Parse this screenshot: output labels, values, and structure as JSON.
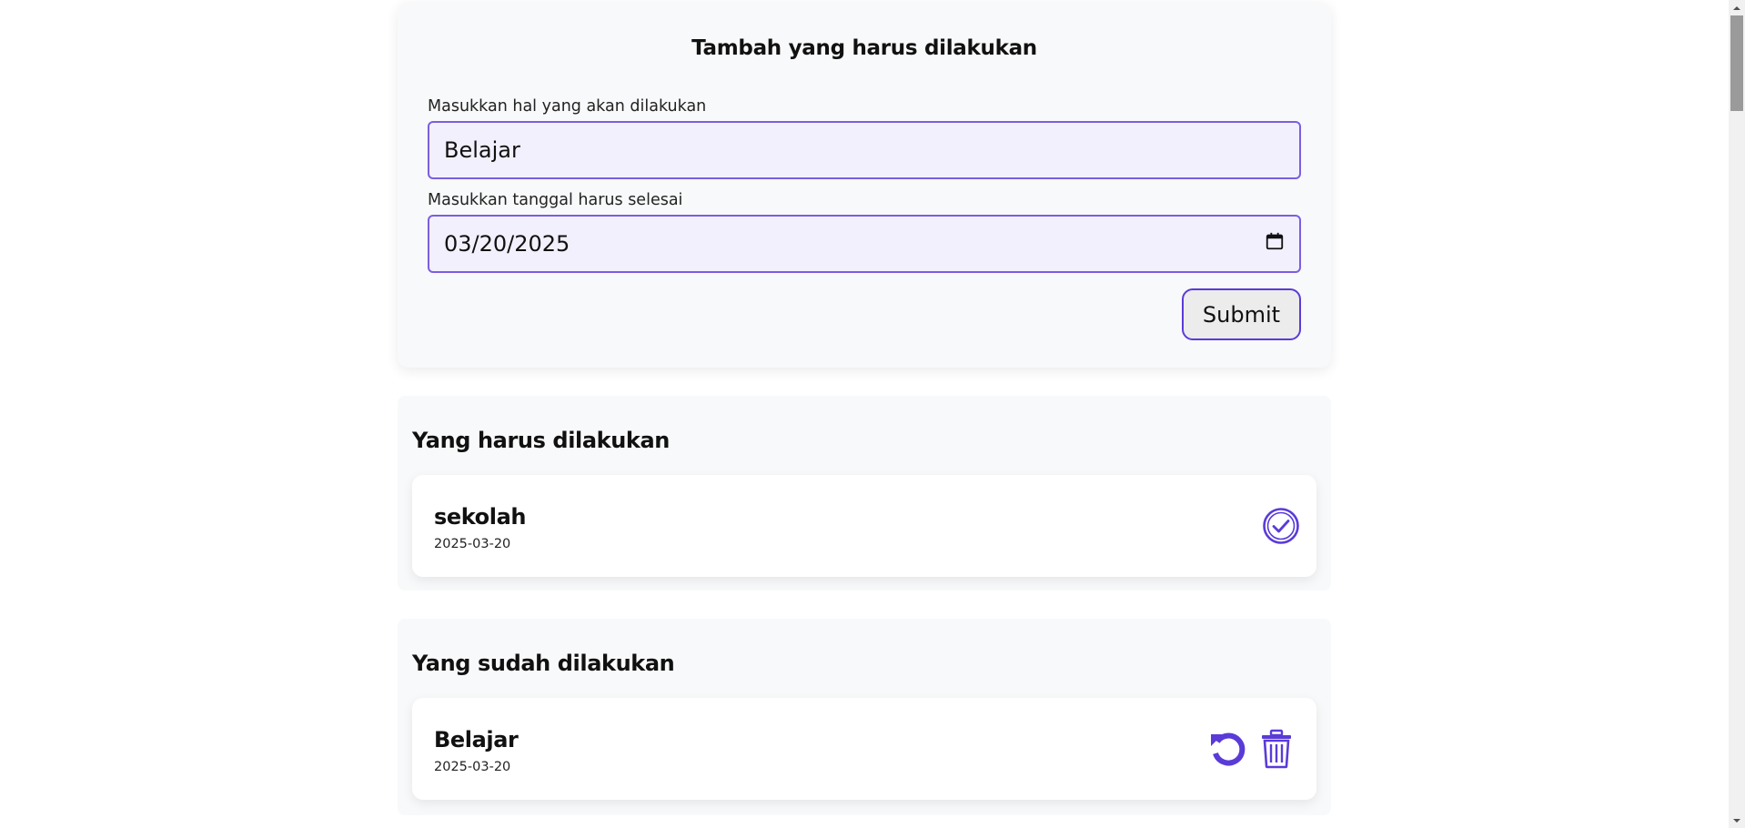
{
  "form": {
    "title": "Tambah yang harus dilakukan",
    "task_label": "Masukkan hal yang akan dilakukan",
    "task_value": "Belajar",
    "date_label": "Masukkan tanggal harus selesai",
    "date_value": "03/20/2025",
    "submit_label": "Submit"
  },
  "todo": {
    "title": "Yang harus dilakukan",
    "items": [
      {
        "title": "sekolah",
        "date": "2025-03-20"
      }
    ]
  },
  "done": {
    "title": "Yang sudah dilakukan",
    "items": [
      {
        "title": "Belajar",
        "date": "2025-03-20"
      }
    ]
  },
  "colors": {
    "accent": "#5a3bd8",
    "input_bg": "#f3f0fd",
    "card_bg": "#f8f9fa"
  },
  "icons": {
    "calendar": "calendar-icon",
    "check": "check-circle-icon",
    "undo": "undo-icon",
    "trash": "trash-icon"
  }
}
